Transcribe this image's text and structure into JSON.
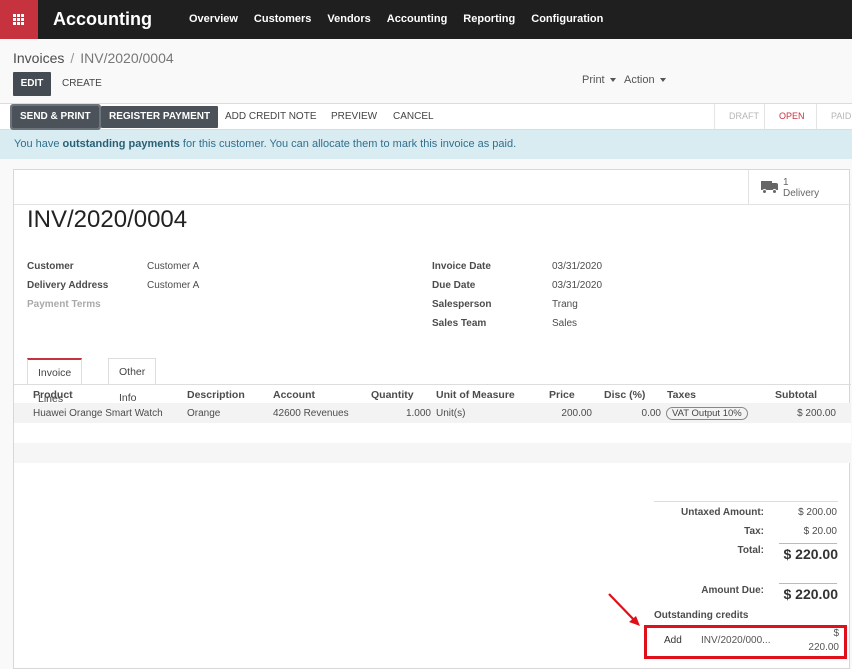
{
  "navbar": {
    "brand": "Accounting",
    "menu": [
      "Overview",
      "Customers",
      "Vendors",
      "Accounting",
      "Reporting",
      "Configuration"
    ]
  },
  "breadcrumb": {
    "root": "Invoices",
    "separator": "/",
    "current": "INV/2020/0004"
  },
  "control": {
    "edit": "EDIT",
    "create": "CREATE",
    "print": "Print",
    "action": "Action"
  },
  "statusbar": {
    "send_print": "SEND & PRINT",
    "register_payment": "REGISTER PAYMENT",
    "add_credit_note": "ADD CREDIT NOTE",
    "preview": "PREVIEW",
    "cancel": "CANCEL",
    "stages": [
      "DRAFT",
      "OPEN",
      "PAID"
    ],
    "active_stage": "OPEN"
  },
  "alert": {
    "prefix": "You have ",
    "strong": "outstanding payments",
    "suffix": " for this customer. You can allocate them to mark this invoice as paid."
  },
  "smart_button": {
    "count": "1",
    "label": "Delivery"
  },
  "invoice": {
    "title": "INV/2020/0004",
    "left_fields": [
      {
        "label": "Customer",
        "value": "Customer A"
      },
      {
        "label": "Delivery Address",
        "value": "Customer A"
      },
      {
        "label": "Payment Terms",
        "value": ""
      }
    ],
    "right_fields": [
      {
        "label": "Invoice Date",
        "value": "03/31/2020"
      },
      {
        "label": "Due Date",
        "value": "03/31/2020"
      },
      {
        "label": "Salesperson",
        "value": "Trang"
      },
      {
        "label": "Sales Team",
        "value": "Sales"
      }
    ]
  },
  "tabs": [
    "Invoice Lines",
    "Other Info"
  ],
  "lines": {
    "headers": [
      "Product",
      "Description",
      "Account",
      "Quantity",
      "Unit of Measure",
      "Price",
      "Disc (%)",
      "Taxes",
      "Subtotal"
    ],
    "rows": [
      {
        "product": "Huawei Orange Smart Watch",
        "description": "Orange",
        "account": "42600 Revenues",
        "quantity": "1.000",
        "uom": "Unit(s)",
        "price": "200.00",
        "discount": "0.00",
        "taxes": "VAT Output 10%",
        "subtotal": "$ 200.00"
      }
    ]
  },
  "totals": {
    "untaxed_label": "Untaxed Amount:",
    "untaxed_value": "$ 200.00",
    "tax_label": "Tax:",
    "tax_value": "$ 20.00",
    "total_label": "Total:",
    "total_value": "$ 220.00",
    "due_label": "Amount Due:",
    "due_value": "$ 220.00"
  },
  "outstanding": {
    "title": "Outstanding credits",
    "add": "Add",
    "ref": "INV/2020/000...",
    "amount_line1": "$",
    "amount_line2": "220.00"
  },
  "colors": {
    "brand_red": "#c7323f",
    "navbar": "#1f1f1f",
    "highlight": "#e0101a"
  }
}
